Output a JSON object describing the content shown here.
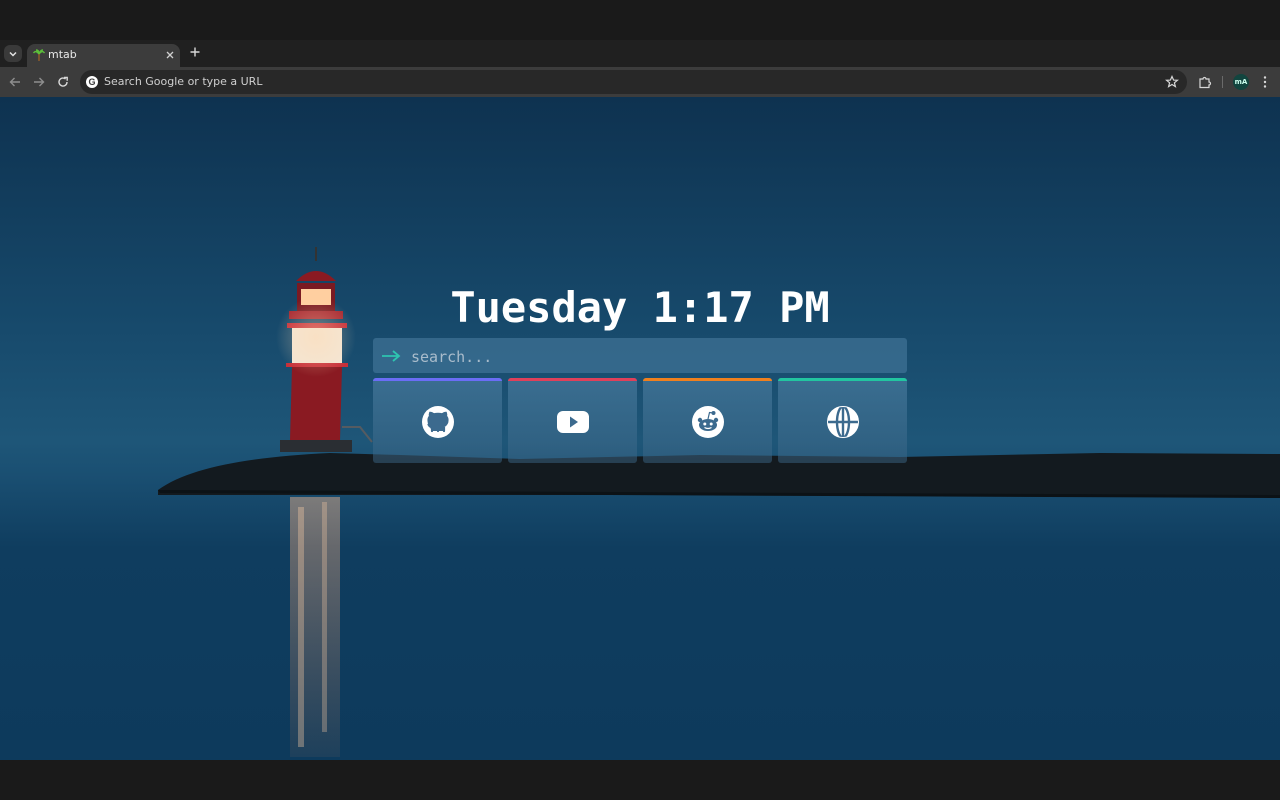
{
  "browser": {
    "tab": {
      "title": "mtab"
    },
    "omnibox": {
      "placeholder": "Search Google or type a URL"
    },
    "profile": {
      "initials": "mA"
    }
  },
  "page": {
    "clock": {
      "day": "Tuesday",
      "time": "1:17 PM"
    },
    "search": {
      "placeholder": "search..."
    },
    "links": [
      {
        "name": "github",
        "icon": "github-icon",
        "accent": "#6b6df5"
      },
      {
        "name": "youtube",
        "icon": "youtube-icon",
        "accent": "#e0405a"
      },
      {
        "name": "reddit",
        "icon": "reddit-icon",
        "accent": "#f0801e"
      },
      {
        "name": "web",
        "icon": "globe-icon",
        "accent": "#22c5a0"
      }
    ]
  },
  "colors": {
    "search_arrow": "#2ec4b0"
  }
}
